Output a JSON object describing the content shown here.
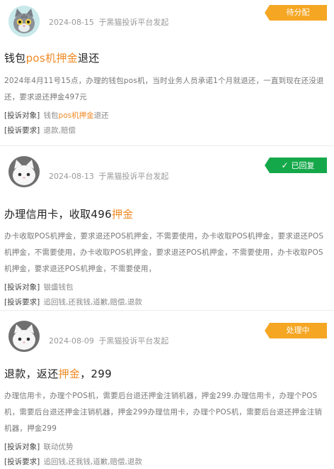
{
  "complaints": [
    {
      "date": "2024-08-15",
      "source": "于黑猫投诉平台发起",
      "status": "待分配",
      "title_before": "钱包",
      "title_highlight": "pos机押金",
      "title_after": "退还",
      "description": "2024年4月11号15点，办理的钱包pos机，当时业务人员承诺1个月就退还，一直到现在还没退还，要求退还押金497元",
      "target_label": "[投诉对象]",
      "target_before": "钱包",
      "target_highlight": "pos机押金",
      "target_after": "退还",
      "demand_label": "[投诉要求]",
      "demand_value": "退款,赔偿"
    },
    {
      "date": "2024-08-13",
      "source": "于黑猫投诉平台发起",
      "status": "已回复",
      "title_before": "办理信用卡，收取496",
      "title_highlight": "押金",
      "title_after": "",
      "description": "办卡收取POS机押金，要求退还POS机押金，不需要使用，办卡收取POS机押金，要求退还POS机押金，不需要使用，办卡收取POS机押金，要求退还POS机押金，不需要使用，办卡收取POS机押金，要求退还POS机押金，不需要使用，",
      "target_label": "[投诉对象]",
      "target_value": "银盛钱包",
      "demand_label": "[投诉要求]",
      "demand_value": "追回钱,还我钱,道歉,赔偿,退款"
    },
    {
      "date": "2024-08-09",
      "source": "于黑猫投诉平台发起",
      "status": "处理中",
      "title_before": "退款，返还",
      "title_highlight": "押金",
      "title_after": "，299",
      "description": "办理信用卡，办理个POS机，需要后台退还押金注销机器，押金299.办理信用卡，办理个POS机，需要后台退还押金注销机器，押金299办理信用卡，办理个POS机，需要后台退还押金注销机器，押金299",
      "target_label": "[投诉对象]",
      "target_value": "联动优势",
      "demand_label": "[投诉要求]",
      "demand_value": "追回钱,还我钱,道歉,赔偿,退款"
    }
  ],
  "icons": {
    "avatar_1": "gray-cat-avatar",
    "avatar_2": "white-cat-avatar",
    "avatar_3": "white-cat-avatar",
    "replied_check": "check-icon"
  },
  "colors": {
    "highlight": "#f08a24",
    "badge_pending": "#f5a623",
    "badge_replied": "#15a84a",
    "badge_processing": "#f5a623"
  }
}
